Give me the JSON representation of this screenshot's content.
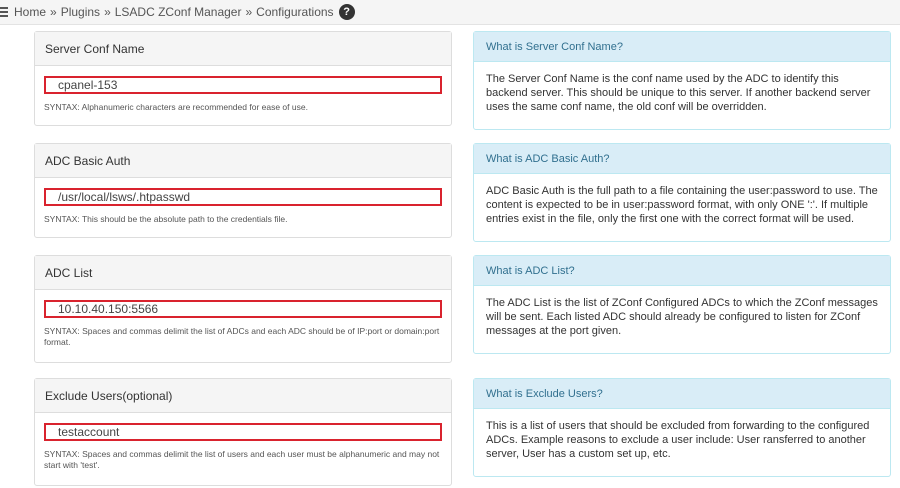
{
  "breadcrumb": {
    "items": [
      "Home",
      "Plugins",
      "LSADC ZConf Manager",
      "Configurations"
    ],
    "separator": "»",
    "help_glyph": "?"
  },
  "icons": {
    "menu": "hamburger-menu-icon",
    "help": "question-circle-icon"
  },
  "colors": {
    "field_highlight": "#d9232e",
    "info_header_bg": "#d9edf7",
    "info_header_text": "#31708f"
  },
  "settings": [
    {
      "label": "Server Conf Name",
      "value": "cpanel-153",
      "syntax": "SYNTAX: Alphanumeric characters are recommended for ease of use.",
      "help_title": "What is Server Conf Name?",
      "help_text": "The Server Conf Name is the conf name used by the ADC to identify this backend server. This should be unique to this server. If another backend server uses the same conf name, the old conf will be overridden."
    },
    {
      "label": "ADC Basic Auth",
      "value": "/usr/local/lsws/.htpasswd",
      "syntax": "SYNTAX: This should be the absolute path to the credentials file.",
      "help_title": "What is ADC Basic Auth?",
      "help_text": "ADC Basic Auth is the full path to a file containing the user:password to use. The content is expected to be in user:password format, with only ONE ':'. If multiple entries exist in the file, only the first one with the correct format will be used."
    },
    {
      "label": "ADC List",
      "value": "10.10.40.150:5566",
      "syntax": "SYNTAX: Spaces and commas delimit the list of ADCs and each ADC should be of IP:port or domain:port format.",
      "help_title": "What is ADC List?",
      "help_text": "The ADC List is the list of ZConf Configured ADCs to which the ZConf messages will be sent. Each listed ADC should already be configured to listen for ZConf messages at the port given."
    },
    {
      "label": "Exclude Users(optional)",
      "value": "testaccount",
      "syntax": "SYNTAX: Spaces and commas delimit the list of users and each user must be alphanumeric and may not start with 'test'.",
      "help_title": "What is Exclude Users?",
      "help_text": "This is a list of users that should be excluded from forwarding to the configured ADCs. Example reasons to exclude a user include: User ransferred to another server, User has a custom set up, etc."
    }
  ]
}
